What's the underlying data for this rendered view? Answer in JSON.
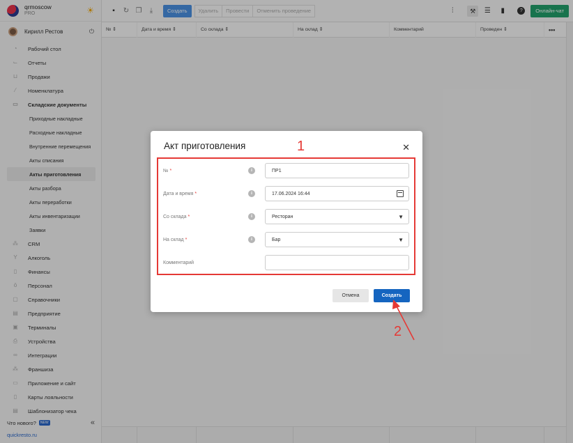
{
  "brand": {
    "name": "qrmoscow",
    "plan": "PRO"
  },
  "user": {
    "name": "Кирилл Рестов"
  },
  "sidebar": {
    "items": [
      {
        "label": "Рабочий стол",
        "icon": "gauge-icon"
      },
      {
        "label": "Отчеты",
        "icon": "chart-icon"
      },
      {
        "label": "Продажи",
        "icon": "cart-icon"
      },
      {
        "label": "Номенклатура",
        "icon": "tag-icon"
      },
      {
        "label": "Складские документы",
        "icon": "box-icon"
      }
    ],
    "subitems": [
      "Приходные накладные",
      "Расходные накладные",
      "Внутренние перемещения",
      "Акты списания",
      "Акты приготовления",
      "Акты разбора",
      "Акты переработки",
      "Акты инвентаризации",
      "Заявки"
    ],
    "items2": [
      {
        "label": "CRM",
        "icon": "people-icon"
      },
      {
        "label": "Алкоголь",
        "icon": "glass-icon"
      },
      {
        "label": "Финансы",
        "icon": "wallet-icon"
      },
      {
        "label": "Персонал",
        "icon": "person-icon"
      },
      {
        "label": "Справочники",
        "icon": "book-icon"
      },
      {
        "label": "Предприятие",
        "icon": "building-icon"
      },
      {
        "label": "Терминалы",
        "icon": "terminal-icon"
      },
      {
        "label": "Устройства",
        "icon": "printer-icon"
      },
      {
        "label": "Интеграции",
        "icon": "link-icon"
      },
      {
        "label": "Франшиза",
        "icon": "network-icon"
      },
      {
        "label": "Приложение и сайт",
        "icon": "monitor-icon"
      },
      {
        "label": "Карты лояльности",
        "icon": "card-icon"
      },
      {
        "label": "Шаблонизатор чека",
        "icon": "receipt-icon"
      }
    ],
    "whats_new": "Что нового?",
    "new_badge": "NEW",
    "footer_link": "quickresto.ru"
  },
  "toolbar": {
    "create": "Создать",
    "delete": "Удалить",
    "post": "Провести",
    "unpost": "Отменить проведение",
    "chat": "Онлайн-чат"
  },
  "table": {
    "columns": [
      "№",
      "Дата и время",
      "Со склада",
      "На склад",
      "Комментарий",
      "Проведен"
    ]
  },
  "dialog": {
    "title": "Акт приготовления",
    "fields": {
      "number": {
        "label": "№",
        "value": "ПР1"
      },
      "datetime": {
        "label": "Дата и время",
        "value": "17.06.2024 16:44"
      },
      "from": {
        "label": "Со склада",
        "value": "Ресторан"
      },
      "to": {
        "label": "На склад",
        "value": "Бар"
      },
      "comment": {
        "label": "Комментарий",
        "value": ""
      }
    },
    "cancel": "Отмена",
    "submit": "Создать"
  },
  "annotations": {
    "one": "1",
    "two": "2",
    "color": "#e53935"
  }
}
